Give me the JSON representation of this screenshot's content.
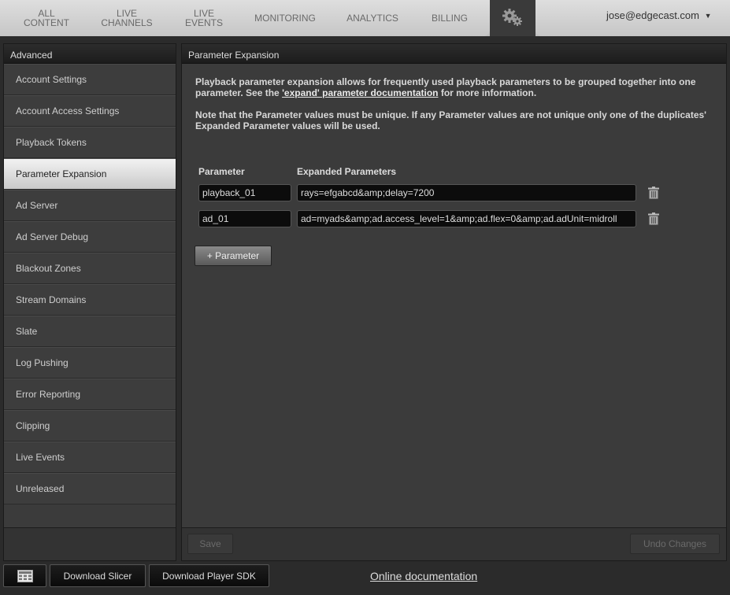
{
  "nav": {
    "tabs": [
      {
        "label": "ALL\nCONTENT"
      },
      {
        "label": "LIVE\nCHANNELS"
      },
      {
        "label": "LIVE\nEVENTS"
      },
      {
        "label": "MONITORING"
      },
      {
        "label": "ANALYTICS"
      },
      {
        "label": "BILLING"
      }
    ],
    "gear_icon": "gears-icon",
    "user": "jose@edgecast.com",
    "user_caret": "▼"
  },
  "sidebar": {
    "header": "Advanced",
    "items": [
      {
        "label": "Account Settings"
      },
      {
        "label": "Account Access Settings"
      },
      {
        "label": "Playback Tokens"
      },
      {
        "label": "Parameter Expansion",
        "active": true
      },
      {
        "label": "Ad Server"
      },
      {
        "label": "Ad Server Debug"
      },
      {
        "label": "Blackout Zones"
      },
      {
        "label": "Stream Domains"
      },
      {
        "label": "Slate"
      },
      {
        "label": "Log Pushing"
      },
      {
        "label": "Error Reporting"
      },
      {
        "label": "Clipping"
      },
      {
        "label": "Live Events"
      },
      {
        "label": "Unreleased"
      }
    ]
  },
  "panel": {
    "header": "Parameter Expansion",
    "desc_before": "Playback parameter expansion allows for frequently used playback parameters to be grouped together into one parameter. See the ",
    "desc_link": "'expand' parameter documentation",
    "desc_after": " for more information.",
    "note": "Note that the Parameter values must be unique. If any Parameter values are not unique only one of the duplicates' Expanded Parameter values will be used.",
    "col_parameter": "Parameter",
    "col_expanded": "Expanded Parameters",
    "rows": [
      {
        "parameter": "playback_01",
        "expanded": "rays=efgabcd&amp;delay=7200"
      },
      {
        "parameter": "ad_01",
        "expanded": "ad=myads&amp;ad.access_level=1&amp;ad.flex=0&amp;ad.adUnit=midroll"
      }
    ],
    "add_button": "+ Parameter",
    "save_button": "Save",
    "undo_button": "Undo Changes"
  },
  "bottom": {
    "download_slicer": "Download Slicer",
    "download_sdk": "Download Player SDK",
    "online_doc": "Online documentation"
  }
}
